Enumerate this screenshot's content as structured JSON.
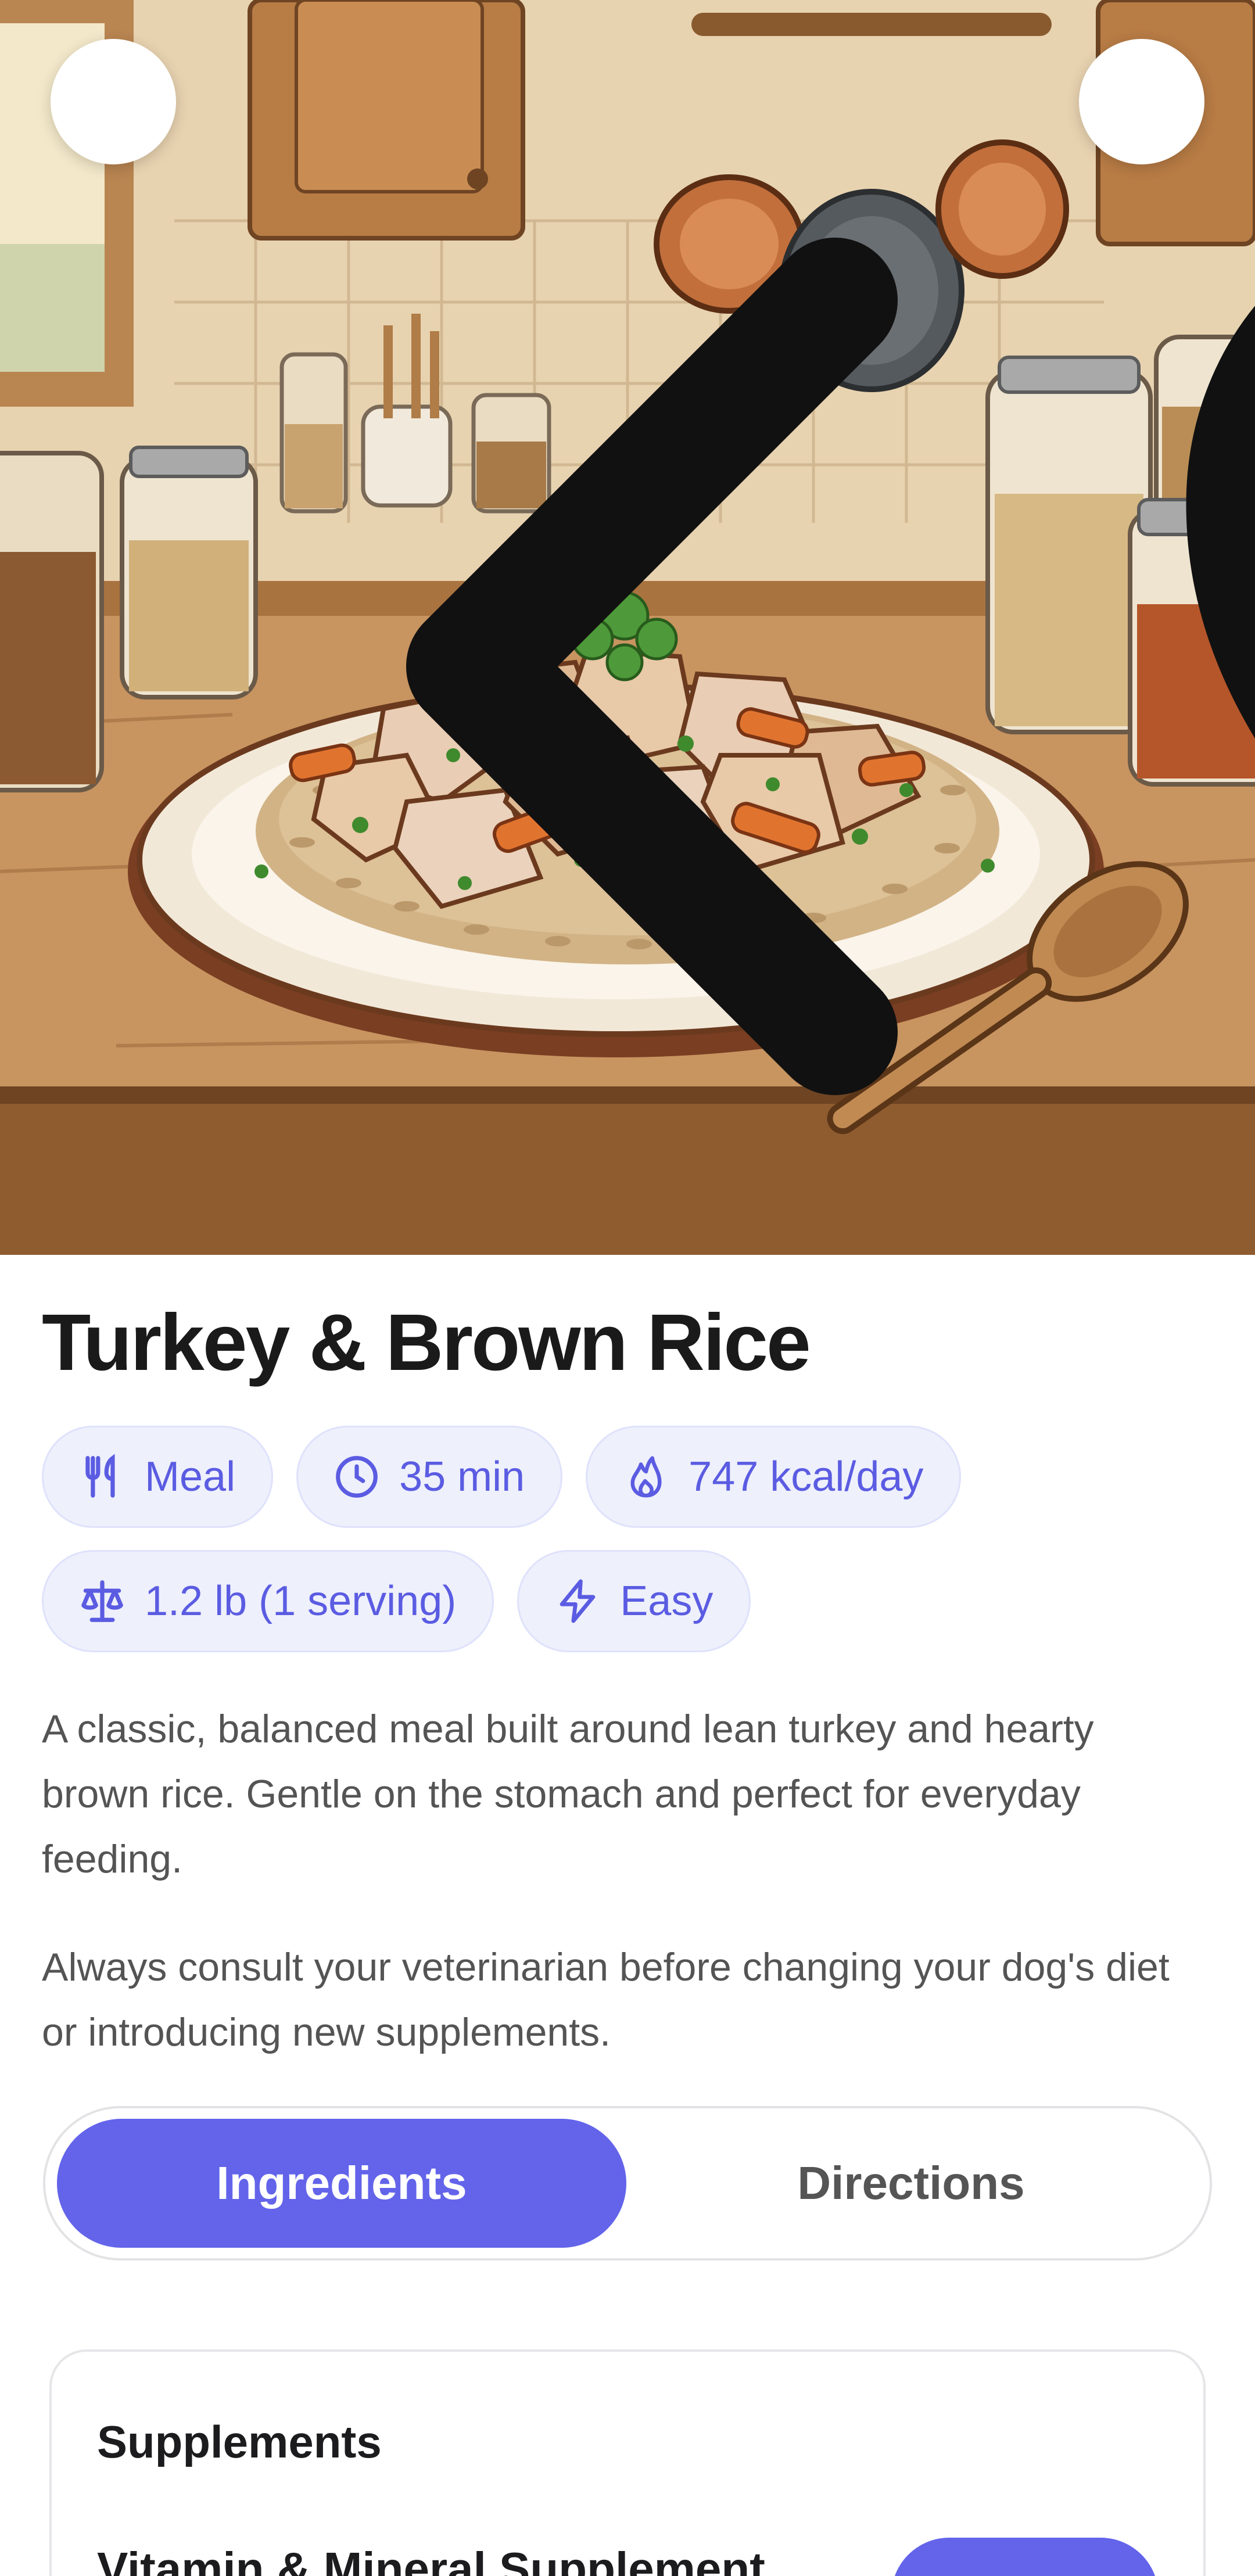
{
  "hero": {
    "image_description_icon": "kitchen-plate-illustration",
    "back_icon": "chevron-left-icon",
    "favorite_icon": "heart-outline-icon"
  },
  "recipe": {
    "title": "Turkey & Brown Rice",
    "chips": {
      "type": "Meal",
      "time": "35 min",
      "calories": "747 kcal/day",
      "portion": "1.2 lb (1 serving)",
      "difficulty": "Easy"
    },
    "description": "A classic, balanced meal built around lean turkey and hearty brown rice. Gentle on the stomach and perfect for everyday feeding.",
    "disclaimer": "Always consult your veterinarian before changing your dog's diet or introducing new supplements."
  },
  "tabs": {
    "active": "Ingredients",
    "ingredients_label": "Ingredients",
    "directions_label": "Directions"
  },
  "supplements": {
    "title": "Supplements",
    "items": [
      {
        "name": "Vitamin & Mineral Supplement"
      }
    ]
  },
  "colors": {
    "accent": "#6364EA",
    "chip_bg": "#EEF0FC",
    "chip_text": "#5B5CE2"
  }
}
